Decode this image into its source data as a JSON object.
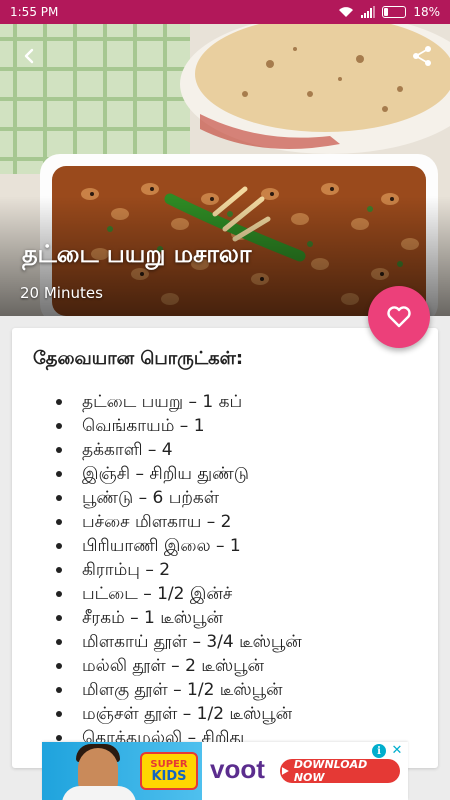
{
  "status_bar": {
    "time": "1:55 PM",
    "battery": "18%",
    "battery_level": 0.18,
    "icons": [
      "wifi-icon",
      "signal-icon",
      "battery-icon"
    ]
  },
  "recipe": {
    "title": "தட்டை பயறு மசாலா",
    "time": "20 Minutes",
    "ingredients_heading": "தேவையான பொருட்கள்:",
    "ingredients": [
      "தட்டை பயறு – 1 கப்",
      "வெங்காயம் – 1",
      "தக்காளி – 4",
      "இஞ்சி – சிறிய துண்டு",
      "பூண்டு – 6 பற்கள்",
      "பச்சை மிளகாய – 2",
      "பிரியாணி இலை – 1",
      "கிராம்பு – 2",
      "பட்டை – 1/2 இன்ச்",
      "சீரகம் – 1 டீஸ்பூன்",
      "மிளகாய் தூள் – 3/4 டீஸ்பூன்",
      "மல்லி தூள் – 2 டீஸ்பூன்",
      "மிளகு தூள் – 1/2 டீஸ்பூன்",
      "மஞ்சள் தூள் – 1/2 டீஸ்பூன்",
      "கொத்தமல்லி – சிறிது"
    ]
  },
  "ad": {
    "brand_badge_top": "SUPER",
    "brand_badge_bottom": "KIDS",
    "logo": "voot",
    "cta": "DOWNLOAD NOW",
    "info": "i",
    "close": "✕"
  },
  "colors": {
    "status_bar": "#b2185a",
    "fab": "#ec407a",
    "voot_purple": "#5b2d8e",
    "cta_red": "#e53935"
  }
}
